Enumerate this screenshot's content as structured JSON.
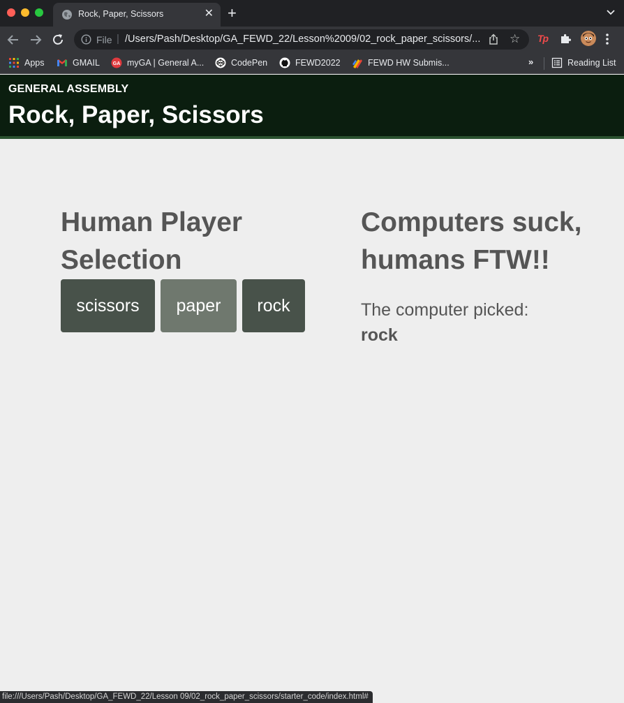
{
  "browser": {
    "tab": {
      "title": "Rock, Paper, Scissors",
      "close": "✕"
    },
    "new_tab": "+",
    "omnibox": {
      "scheme": "File",
      "url": "/Users/Pash/Desktop/GA_FEWD_22/Lesson%2009/02_rock_paper_scissors/..."
    },
    "icons": [
      "back-arrow-icon",
      "forward-arrow-icon",
      "reload-icon",
      "info-icon",
      "share-icon",
      "star-icon",
      "tp-extension-icon",
      "puzzle-icon",
      "avatar",
      "kebab-menu-icon"
    ],
    "extension_label": "Tp",
    "bookmarks": [
      {
        "label": "Apps",
        "icon": "apps-grid-icon"
      },
      {
        "label": "GMAIL",
        "icon": "gmail-icon"
      },
      {
        "label": "myGA | General A...",
        "icon": "ga-icon"
      },
      {
        "label": "CodePen",
        "icon": "codepen-icon"
      },
      {
        "label": "FEWD2022",
        "icon": "github-icon"
      },
      {
        "label": "FEWD HW Submis...",
        "icon": "submission-icon"
      }
    ],
    "bookmarks_overflow": "»",
    "reading_list": "Reading List",
    "status_url": "file:///Users/Pash/Desktop/GA_FEWD_22/Lesson 09/02_rock_paper_scissors/starter_code/index.html#"
  },
  "page": {
    "brand": "GENERAL ASSEMBLY",
    "title": "Rock, Paper, Scissors",
    "human": {
      "heading": "Human Player Selection",
      "choices": [
        "scissors",
        "paper",
        "rock"
      ]
    },
    "computer": {
      "result": "Computers suck, humans FTW!!",
      "picked_label": "The computer picked:",
      "picked_value": "rock"
    }
  },
  "colors": {
    "header_bg": "#0b1e0f",
    "header_border": "#2b5230",
    "page_bg": "#eeeeee",
    "text": "#555555",
    "button_dark": "#48524a",
    "button_light": "#6f786e"
  }
}
